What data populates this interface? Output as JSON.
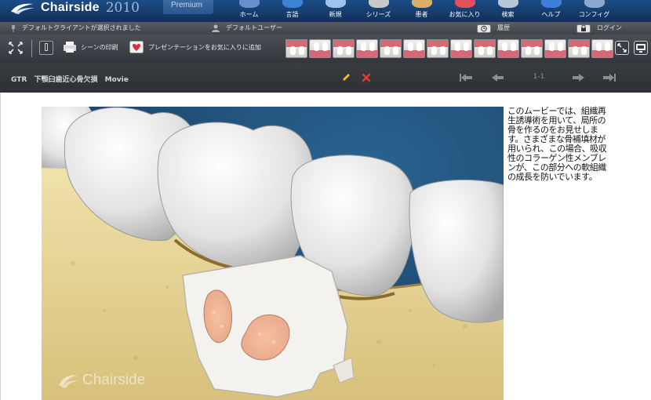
{
  "header": {
    "app_name": "Chairside",
    "year": "2010",
    "edition": "Premium",
    "nav": [
      {
        "label": "ホーム",
        "icon": "home-icon",
        "color": "#6a8fd0"
      },
      {
        "label": "言語",
        "icon": "language-icon",
        "color": "#3d83d6"
      },
      {
        "label": "新規",
        "icon": "new-icon",
        "color": "#9cc4ee"
      },
      {
        "label": "シリーズ",
        "icon": "series-icon",
        "color": "#c9c9c9"
      },
      {
        "label": "患者",
        "icon": "patient-icon",
        "color": "#d8b06a"
      },
      {
        "label": "お気に入り",
        "icon": "favorites-icon",
        "color": "#e0505e"
      },
      {
        "label": "検索",
        "icon": "search-icon",
        "color": "#b8c7da"
      },
      {
        "label": "ヘルプ",
        "icon": "help-icon",
        "color": "#3f7fd8"
      },
      {
        "label": "コンフィグ",
        "icon": "config-icon",
        "color": "#8ea9cf"
      }
    ]
  },
  "status": {
    "client": "デフォルトクライアントが選択されました",
    "user": "デフォルトユーザー",
    "history": "履歴",
    "login": "ログイン"
  },
  "toolbar": {
    "print_scene": "シーンの印刷",
    "add_favorite": "プレゼンテーションをお気に入りに追加"
  },
  "player": {
    "prefix": "GTR",
    "title": "下顎臼歯近心骨欠損",
    "type": "Movie",
    "page": "1-1"
  },
  "content": {
    "description": "このムービーでは、組織再生誘導術を用いて、局所の骨を作るのをお見せします。さまざまな骨補填材が用いられ、この場合、吸収性のコラーゲン性メンブレンが、この部分への軟組織の成長を防いでいます。",
    "watermark": "Chairside"
  },
  "colors": {
    "header": "#1a4477",
    "toolbar": "#3d4046",
    "bone": "#e7d59a",
    "background": "#1d4f7a"
  }
}
